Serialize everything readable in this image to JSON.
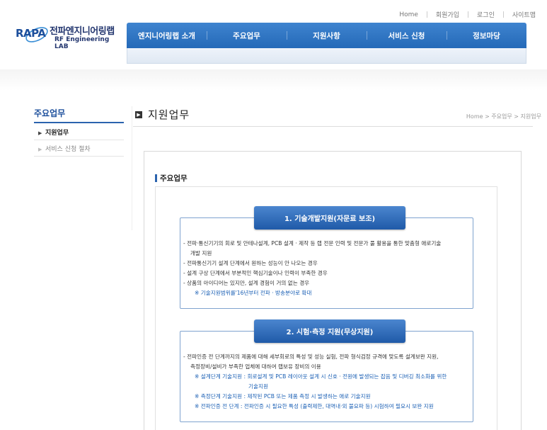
{
  "util_links": [
    "Home",
    "회원가입",
    "로그인",
    "사이트맵"
  ],
  "logo": {
    "mark": "RAPA",
    "korean": "전파엔지니어링랩",
    "english": "RF Engineering LAB"
  },
  "nav": [
    "엔지니어링랩 소개",
    "주요업무",
    "지원사항",
    "서비스 신청",
    "정보마당"
  ],
  "sidebar": {
    "title": "주요업무",
    "items": [
      {
        "label": "지원업무",
        "bullet": "▶"
      },
      {
        "label": "서비스 신청 절차",
        "bullet": "▶"
      }
    ]
  },
  "main": {
    "title_icon": "▶",
    "title": "지원업무",
    "breadcrumb": "Home > 주요업무 > 지원업무",
    "section_title": "주요업무"
  },
  "section1": {
    "heading": "1. 기술개발지원(자문료 보조)",
    "lines": [
      "- 전파·통신기기의 회로 및 안테나설계, PCB 설계 · 제작 등 랩 전문 인력 및 전문가 풀 활용을 통한 맞춤형 애로기술",
      "개발 지원",
      "- 전파통신기기 설계 단계에서 원하는 성능이 안 나오는 경우",
      "- 설계 구상 단계에서 부분적인 핵심기술이나 인력이 부족한 경우",
      "- 상품의 아이디어는 있지만, 설계 경험이 거의 없는 경우",
      "※ 기술지원범위를'16년부터 전파 · 방송분야로 확대"
    ]
  },
  "section2": {
    "heading": "2. 시험·측정 지원(무상지원)",
    "lines": [
      "- 전파인증 전 단계까지의 제품에 대해 세부회로의 특성 및 성능 실험, 전파 형식검정 규격에 맞도록 설계보완 지원,",
      "측정장비/설비가 부족한 업체에 대하여 랩보유 장비의 이용",
      "※ 설계단계 기술지원 : 회로설계 및 PCB 레이아웃 설계 시 신호 · 전원에 발생되는 잡음 및 디버깅 최소화를 위한",
      "기술지원",
      "※ 측정단계 기술지원 : 제작된 PCB 또는 제품 측정 시 발생하는 애로 기술지원",
      "※ 전파인증 전 단계 : 전파인증 시 필요한 특성 (출력제한, 대역내·외 불요파 등) 시험하여 필요시 보완 지원"
    ]
  }
}
